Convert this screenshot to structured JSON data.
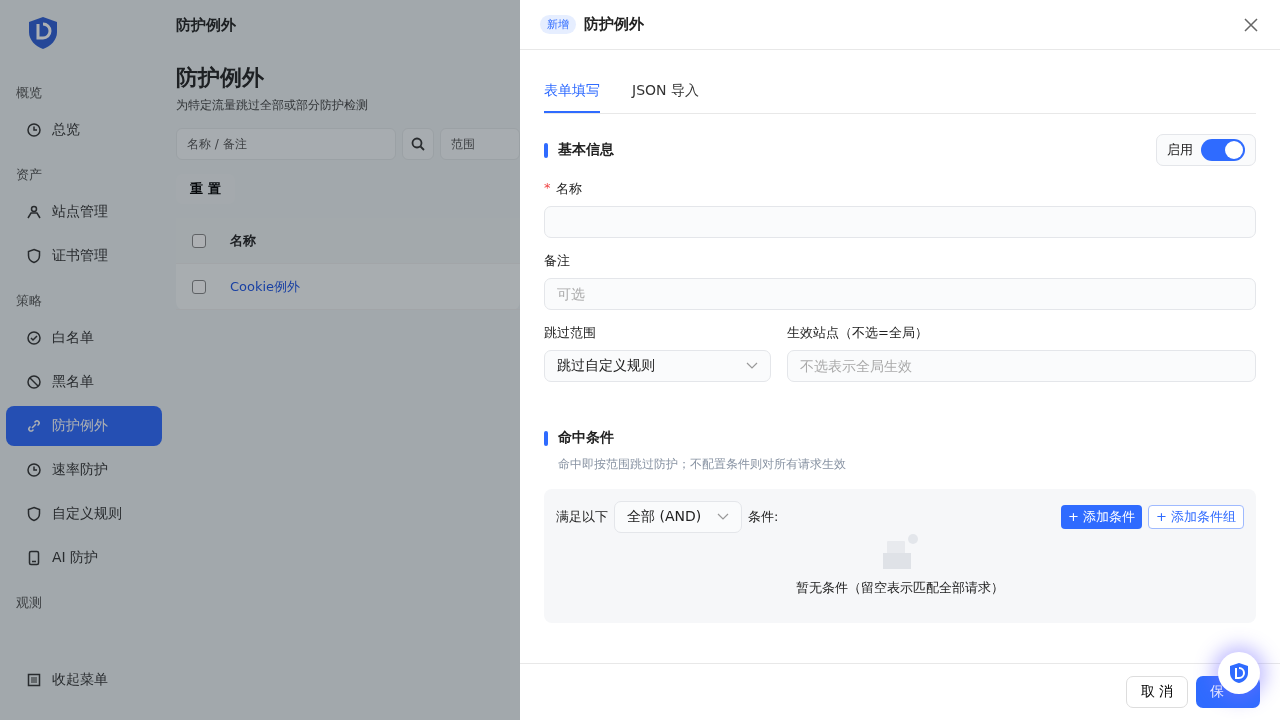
{
  "sidebar": {
    "groups": [
      {
        "heading": "概览",
        "items": [
          {
            "label": "总览",
            "selected": false
          }
        ]
      },
      {
        "heading": "资产",
        "items": [
          {
            "label": "站点管理",
            "selected": false
          },
          {
            "label": "证书管理",
            "selected": false
          }
        ]
      },
      {
        "heading": "策略",
        "items": [
          {
            "label": "白名单",
            "selected": false
          },
          {
            "label": "黑名单",
            "selected": false
          },
          {
            "label": "防护例外",
            "selected": true
          },
          {
            "label": "速率防护",
            "selected": false
          },
          {
            "label": "自定义规则",
            "selected": false
          },
          {
            "label": "AI 防护",
            "selected": false
          }
        ]
      },
      {
        "heading": "观测"
      }
    ],
    "collapse": "收起菜单"
  },
  "page": {
    "breadcrumb": "防护例外",
    "title": "防护例外",
    "subtitle": "为特定流量跳过全部或部分防护检测",
    "search": {
      "placeholder": "名称 / 备注"
    },
    "scope_filter": {
      "placeholder": "范围"
    },
    "reset": "重 置",
    "table": {
      "select_all": {
        "checked": false
      },
      "columns": [
        "名称"
      ],
      "rows": [
        {
          "checked": false,
          "name": "Cookie例外"
        }
      ]
    }
  },
  "drawer": {
    "badge": "新增",
    "title": "防护例外",
    "tabs": [
      {
        "label": "表单填写",
        "selected": true
      },
      {
        "label": "JSON 导入",
        "selected": false
      }
    ],
    "basic": {
      "heading": "基本信息",
      "enable_label": "启用",
      "enabled": true,
      "name": {
        "required_mark": "*",
        "label": "名称"
      },
      "note": {
        "label": "备注",
        "placeholder": "可选"
      },
      "scope": {
        "label": "跳过范围",
        "value": "跳过自定义规则"
      },
      "sites": {
        "label": "生效站点（不选=全局）",
        "placeholder": "不选表示全局生效"
      }
    },
    "conditions": {
      "heading": "命中条件",
      "hint": "命中即按范围跳过防护；不配置条件则对所有请求生效",
      "prefix": "满足以下",
      "mode": "全部 (AND)",
      "suffix": "条件:",
      "add_condition": "+ 添加条件",
      "add_group": "+ 添加条件组",
      "empty": "暂无条件（留空表示匹配全部请求）"
    },
    "cancel": "取 消",
    "save": "保"
  }
}
